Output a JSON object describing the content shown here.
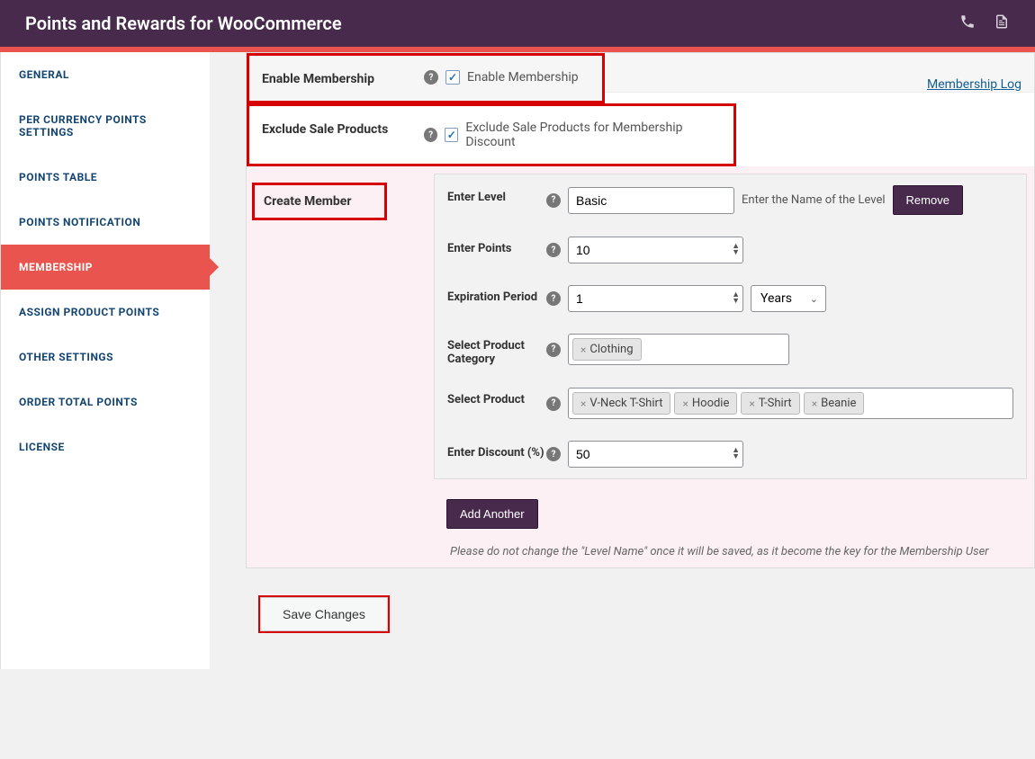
{
  "header": {
    "title": "Points and Rewards for WooCommerce"
  },
  "sidebar": {
    "items": [
      {
        "label": "GENERAL"
      },
      {
        "label": "PER CURRENCY POINTS SETTINGS"
      },
      {
        "label": "POINTS TABLE"
      },
      {
        "label": "POINTS NOTIFICATION"
      },
      {
        "label": "MEMBERSHIP",
        "active": true
      },
      {
        "label": "ASSIGN PRODUCT POINTS"
      },
      {
        "label": "OTHER SETTINGS"
      },
      {
        "label": "ORDER TOTAL POINTS"
      },
      {
        "label": "LICENSE"
      }
    ]
  },
  "enable": {
    "label": "Enable Membership",
    "desc": "Enable Membership",
    "log_link": "Membership Log"
  },
  "exclude": {
    "label": "Exclude Sale Products",
    "desc": "Exclude Sale Products for Membership Discount"
  },
  "create": {
    "label": "Create Member",
    "level_label": "Enter Level",
    "level_value": "Basic",
    "level_hint": "Enter the Name of the Level",
    "remove_btn": "Remove",
    "points_label": "Enter Points",
    "points_value": "10",
    "expire_label": "Expiration Period",
    "expire_value": "1",
    "expire_unit": "Years",
    "category_label": "Select Product Category",
    "category_tags": [
      "Clothing"
    ],
    "product_label": "Select Product",
    "product_tags": [
      "V-Neck T-Shirt",
      "Hoodie",
      "T-Shirt",
      "Beanie"
    ],
    "discount_label": "Enter Discount (%)",
    "discount_value": "50",
    "add_another": "Add Another",
    "note": "Please do not change the \"Level Name\" once it will be saved, as it become the key for the Membership User"
  },
  "save": {
    "label": "Save Changes"
  }
}
